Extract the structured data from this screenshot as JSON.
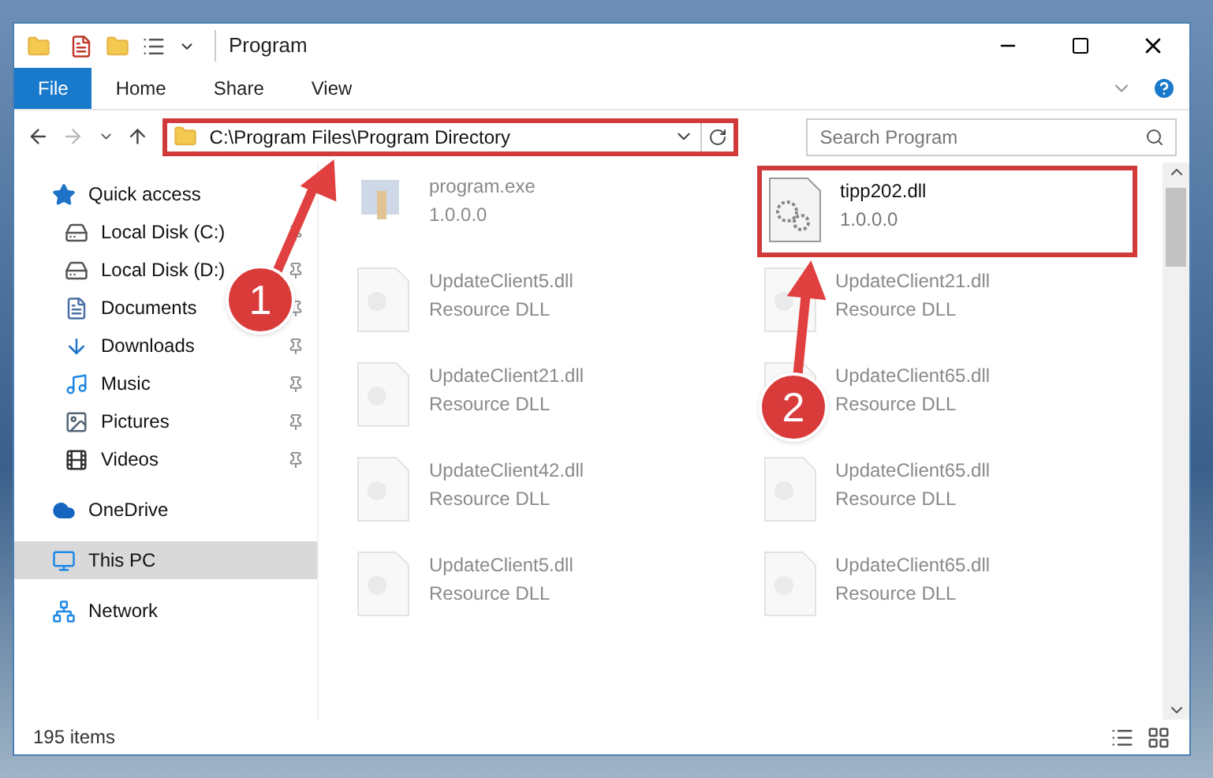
{
  "window": {
    "title": "Program"
  },
  "ribbon": {
    "tabs": [
      {
        "label": "File",
        "selected": true
      },
      {
        "label": "Home",
        "selected": false
      },
      {
        "label": "Share",
        "selected": false
      },
      {
        "label": "View",
        "selected": false
      }
    ]
  },
  "address": {
    "path": "C:\\Program Files\\Program Directory",
    "highlighted": true
  },
  "search": {
    "placeholder": "Search Program"
  },
  "sidebar": {
    "items": [
      {
        "label": "Quick access",
        "kind": "star",
        "selected": false,
        "children": [
          {
            "label": "Local Disk (C:)",
            "kind": "disk",
            "pinned": true,
            "selected": false
          },
          {
            "label": "Local Disk (D:)",
            "kind": "disk",
            "pinned": true,
            "selected": false
          },
          {
            "label": "Documents",
            "kind": "doc",
            "pinned": true,
            "selected": false
          },
          {
            "label": "Downloads",
            "kind": "download",
            "pinned": true,
            "selected": false
          },
          {
            "label": "Music",
            "kind": "music",
            "pinned": true,
            "selected": false
          },
          {
            "label": "Pictures",
            "kind": "pictures",
            "pinned": true,
            "selected": false
          },
          {
            "label": "Videos",
            "kind": "video",
            "pinned": true,
            "selected": false
          }
        ]
      },
      {
        "label": "OneDrive",
        "kind": "cloud",
        "selected": false
      },
      {
        "label": "This PC",
        "kind": "pc",
        "selected": true
      },
      {
        "label": "Network",
        "kind": "network",
        "selected": false
      }
    ]
  },
  "files": [
    {
      "name": "program.exe",
      "detail": "1.0.0.0",
      "kind": "exe",
      "faded": true,
      "highlighted": false
    },
    {
      "name": "tipp202.dll",
      "detail": "1.0.0.0",
      "kind": "dll",
      "faded": false,
      "highlighted": true
    },
    {
      "name": "UpdateClient5.dll",
      "detail": "Resource DLL",
      "kind": "resource",
      "faded": true,
      "highlighted": false
    },
    {
      "name": "UpdateClient21.dll",
      "detail": "Resource DLL",
      "kind": "resource",
      "faded": true,
      "highlighted": false
    },
    {
      "name": "UpdateClient21.dll",
      "detail": "Resource DLL",
      "kind": "resource",
      "faded": true,
      "highlighted": false
    },
    {
      "name": "UpdateClient65.dll",
      "detail": "Resource DLL",
      "kind": "resource",
      "faded": true,
      "highlighted": false
    },
    {
      "name": "UpdateClient42.dll",
      "detail": "Resource DLL",
      "kind": "resource",
      "faded": true,
      "highlighted": false
    },
    {
      "name": "UpdateClient65.dll",
      "detail": "Resource DLL",
      "kind": "resource",
      "faded": true,
      "highlighted": false
    },
    {
      "name": "UpdateClient5.dll",
      "detail": "Resource DLL",
      "kind": "resource",
      "faded": true,
      "highlighted": false
    },
    {
      "name": "UpdateClient65.dll",
      "detail": "Resource DLL",
      "kind": "resource",
      "faded": true,
      "highlighted": false
    }
  ],
  "status_bar": {
    "count": "195 items"
  },
  "annotations": [
    {
      "label": "1"
    },
    {
      "label": "2"
    }
  ]
}
